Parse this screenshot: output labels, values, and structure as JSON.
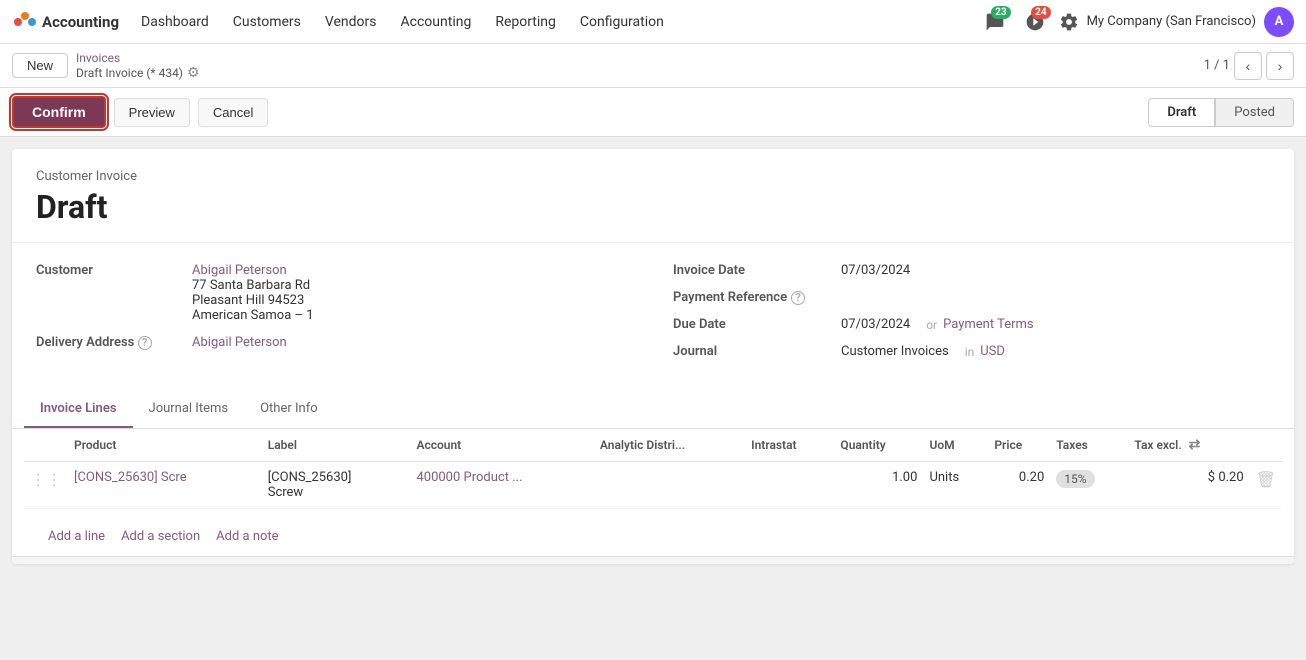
{
  "app": {
    "brand": "Accounting",
    "logo_color": "#e74c3c"
  },
  "topnav": {
    "items": [
      "Dashboard",
      "Customers",
      "Vendors",
      "Accounting",
      "Reporting",
      "Configuration"
    ],
    "notification_count": "23",
    "activity_count": "24",
    "company": "My Company (San Francisco)",
    "avatar_initials": "A"
  },
  "subtoolbar": {
    "new_label": "New",
    "breadcrumb_link": "Invoices",
    "breadcrumb_current": "Draft Invoice (* 434)",
    "page_indicator": "1 / 1"
  },
  "actionbar": {
    "confirm_label": "Confirm",
    "preview_label": "Preview",
    "cancel_label": "Cancel",
    "status_draft": "Draft",
    "status_posted": "Posted"
  },
  "invoice": {
    "type": "Customer Invoice",
    "title": "Draft",
    "customer_label": "Customer",
    "customer_name": "Abigail Peterson",
    "customer_address1": "77 Santa Barbara Rd",
    "customer_address2": "Pleasant Hill 94523",
    "customer_address3": "American Samoa – 1",
    "delivery_address_label": "Delivery Address",
    "delivery_address_value": "Abigail Peterson",
    "invoice_date_label": "Invoice Date",
    "invoice_date_value": "07/03/2024",
    "payment_ref_label": "Payment Reference",
    "due_date_label": "Due Date",
    "due_date_value": "07/03/2024",
    "payment_terms_link": "Payment Terms",
    "journal_label": "Journal",
    "journal_value": "Customer Invoices",
    "currency_value": "USD"
  },
  "tabs": [
    {
      "id": "invoice-lines",
      "label": "Invoice Lines",
      "active": true
    },
    {
      "id": "journal-items",
      "label": "Journal Items",
      "active": false
    },
    {
      "id": "other-info",
      "label": "Other Info",
      "active": false
    }
  ],
  "table": {
    "columns": [
      {
        "id": "product",
        "label": "Product"
      },
      {
        "id": "label",
        "label": "Label"
      },
      {
        "id": "account",
        "label": "Account"
      },
      {
        "id": "analytic",
        "label": "Analytic Distri..."
      },
      {
        "id": "intrastat",
        "label": "Intrastat"
      },
      {
        "id": "quantity",
        "label": "Quantity"
      },
      {
        "id": "uom",
        "label": "UoM"
      },
      {
        "id": "price",
        "label": "Price"
      },
      {
        "id": "taxes",
        "label": "Taxes"
      },
      {
        "id": "tax_excl",
        "label": "Tax excl."
      }
    ],
    "rows": [
      {
        "product": "[CONS_25630] Scre",
        "label_line1": "[CONS_25630]",
        "label_line2": "Screw",
        "account": "400000 Product ...",
        "analytic": "",
        "intrastat": "",
        "quantity": "1.00",
        "uom": "Units",
        "price": "0.20",
        "taxes": "15%",
        "tax_excl": "$ 0.20"
      }
    ]
  },
  "table_footer": {
    "add_line": "Add a line",
    "add_section": "Add a section",
    "add_note": "Add a note"
  }
}
